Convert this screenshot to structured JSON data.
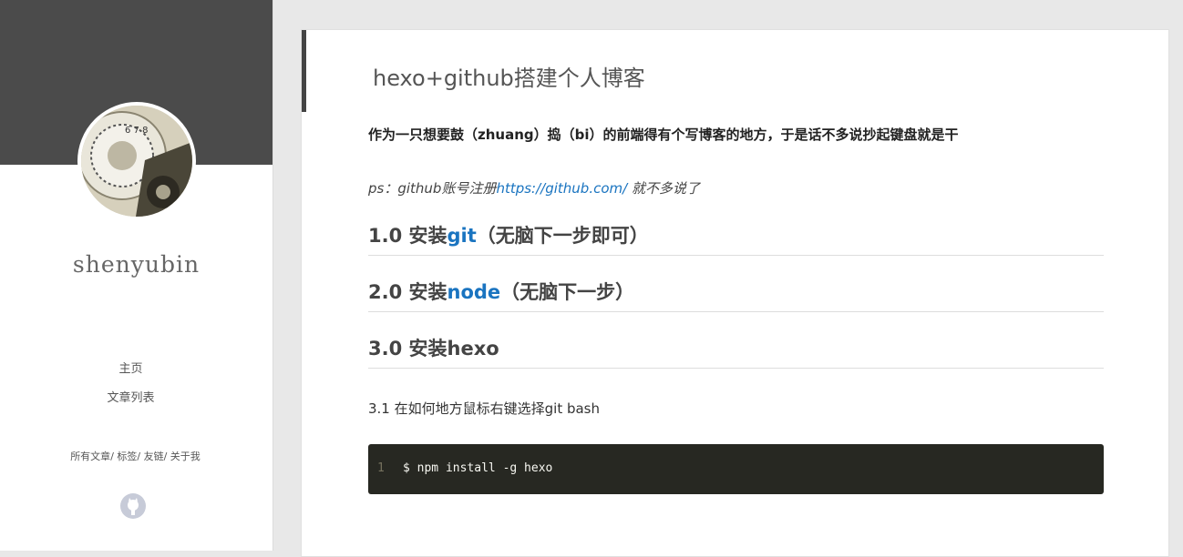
{
  "sidebar": {
    "author": "shenyubin",
    "nav": [
      "主页",
      "文章列表"
    ],
    "links": [
      "所有文章",
      "标签",
      "友链",
      "关于我"
    ],
    "link_sep": "/ ",
    "github_icon": "github-icon"
  },
  "post": {
    "title": "hexo+github搭建个人博客",
    "intro": "作为一只想要鼓（zhuang）捣（bi）的前端得有个写博客的地方，于是话不多说抄起键盘就是干",
    "ps_prefix": "ps：github账号注册",
    "ps_url": "https://github.com/",
    "ps_suffix": " 就不多说了",
    "h1": {
      "prefix": "1.0 安装",
      "link": "git",
      "suffix": "（无脑下一步即可）"
    },
    "h2": {
      "prefix": "2.0 安装",
      "link": "node",
      "suffix": "（无脑下一步）"
    },
    "h3": {
      "text": "3.0 安装hexo"
    },
    "para": "3.1 在如何地方鼠标右键选择git bash",
    "code": {
      "line_no": "1",
      "command": "$ npm install -g hexo"
    }
  },
  "colors": {
    "sidebar_header": "#4b4b4b",
    "link": "#1a74c0",
    "code_bg": "#272822"
  }
}
